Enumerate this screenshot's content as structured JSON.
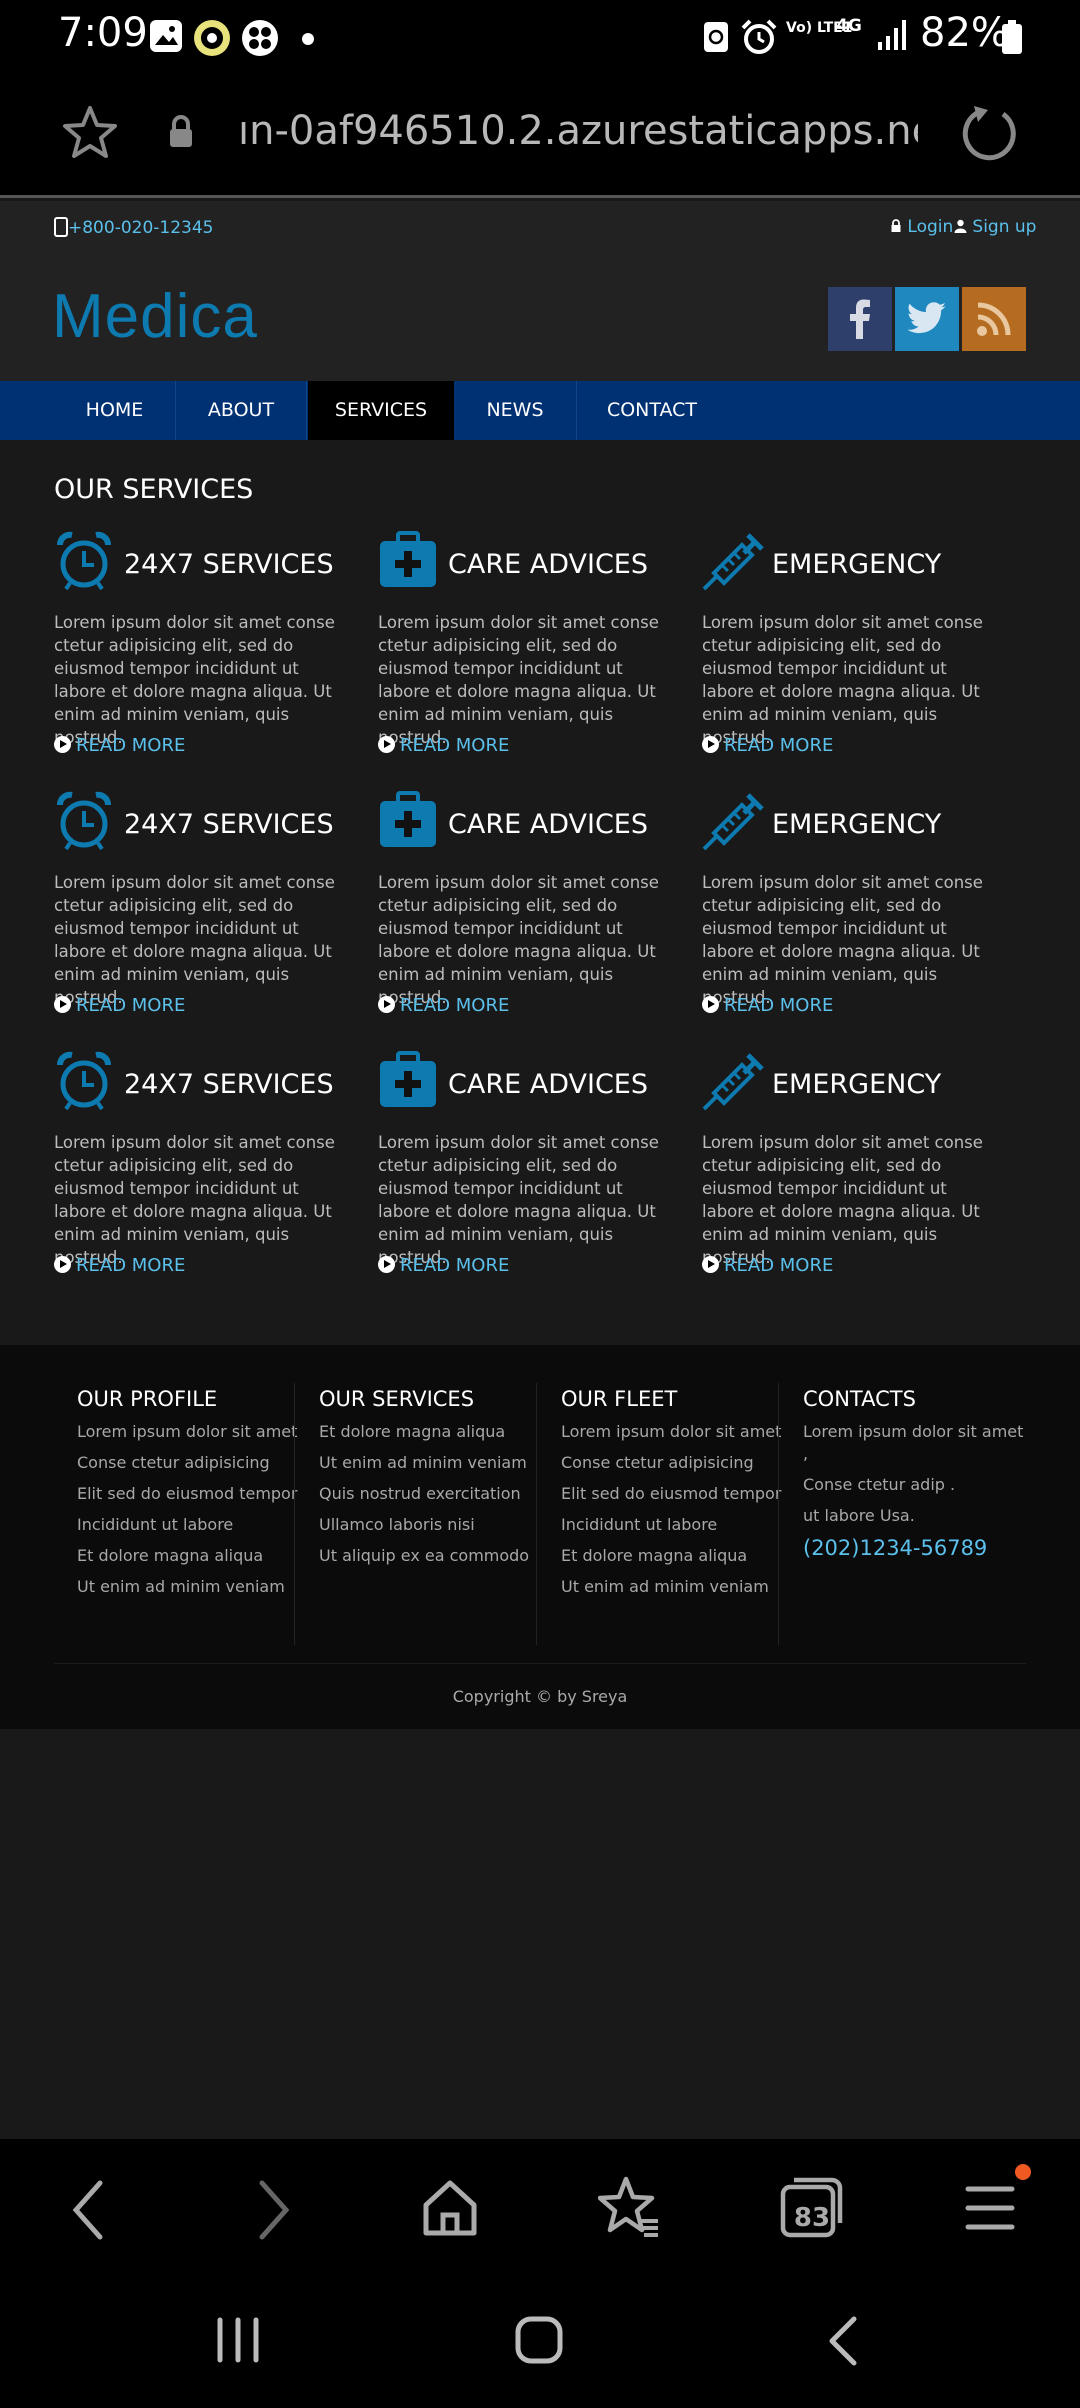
{
  "status": {
    "time": "7:09",
    "battery": "82%",
    "network": "4G",
    "volte": "Vo) LTE1"
  },
  "browser": {
    "url": "ın-0af946510.2.azurestaticapps.net",
    "tab_count": "83"
  },
  "topbar": {
    "phone": "+800-020-12345",
    "login": "Login",
    "signup": "Sign up"
  },
  "brand": {
    "logo": "Medica"
  },
  "nav": {
    "items": [
      "HOME",
      "ABOUT",
      "SERVICES",
      "NEWS",
      "CONTACT"
    ],
    "active": "SERVICES"
  },
  "services": {
    "title": "OUR SERVICES",
    "body": "Lorem ipsum dolor sit amet conse ctetur adipisicing elit, sed do eiusmod tempor incididunt ut labore et dolore magna aliqua. Ut enim ad minim veniam, quis nostrud.",
    "read_more": "READ MORE",
    "cards": [
      {
        "title": "24X7 SERVICES",
        "icon": "alarm-clock-icon"
      },
      {
        "title": "CARE ADVICES",
        "icon": "medical-kit-icon"
      },
      {
        "title": "EMERGENCY",
        "icon": "syringe-icon"
      },
      {
        "title": "24X7 SERVICES",
        "icon": "alarm-clock-icon"
      },
      {
        "title": "CARE ADVICES",
        "icon": "medical-kit-icon"
      },
      {
        "title": "EMERGENCY",
        "icon": "syringe-icon"
      },
      {
        "title": "24X7 SERVICES",
        "icon": "alarm-clock-icon"
      },
      {
        "title": "CARE ADVICES",
        "icon": "medical-kit-icon"
      },
      {
        "title": "EMERGENCY",
        "icon": "syringe-icon"
      }
    ]
  },
  "footer": {
    "columns": [
      {
        "title": "OUR PROFILE",
        "items": [
          "Lorem ipsum dolor sit amet",
          "Conse ctetur adipisicing",
          "Elit sed do eiusmod tempor",
          "Incididunt ut labore",
          "Et dolore magna aliqua",
          "Ut enim ad minim veniam"
        ]
      },
      {
        "title": "OUR SERVICES",
        "items": [
          "Et dolore magna aliqua",
          "Ut enim ad minim veniam",
          "Quis nostrud exercitation",
          "Ullamco laboris nisi",
          "Ut aliquip ex ea commodo"
        ]
      },
      {
        "title": "OUR FLEET",
        "items": [
          "Lorem ipsum dolor sit amet",
          "Conse ctetur adipisicing",
          "Elit sed do eiusmod tempor",
          "Incididunt ut labore",
          "Et dolore magna aliqua",
          "Ut enim ad minim veniam"
        ]
      },
      {
        "title": "CONTACTS",
        "items": [
          "Lorem ipsum dolor sit amet ,",
          "Conse ctetur adip .",
          "ut labore Usa."
        ],
        "phone": "(202)1234-56789"
      }
    ],
    "copyright": "Copyright © by Sreya"
  },
  "colors": {
    "accent": "#5bc0ec",
    "nav_bg": "#003173",
    "logo": "#0d7ab0",
    "facebook": "#3b5998",
    "twitter": "#1b95e0",
    "rss": "#d3822b"
  }
}
